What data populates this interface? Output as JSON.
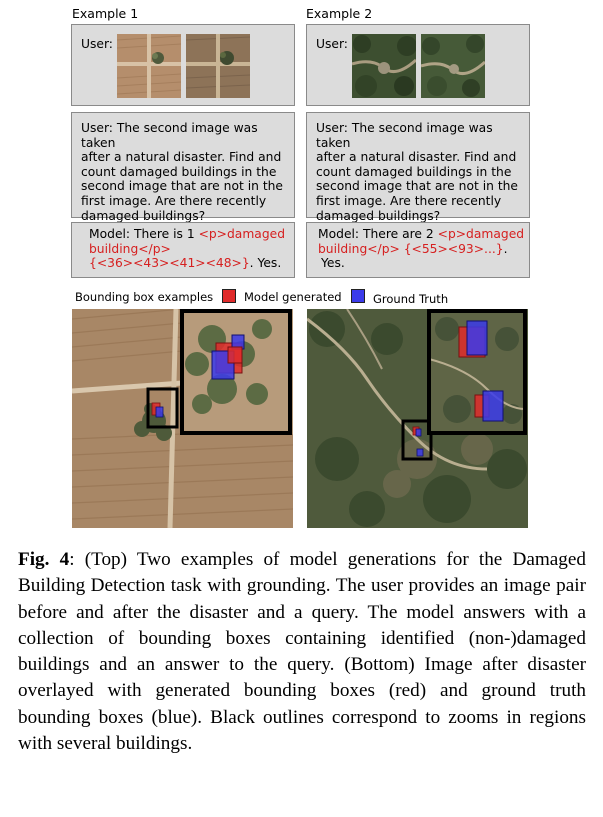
{
  "example1": {
    "title": "Example 1",
    "user_label": "User:",
    "query_lines": [
      "User: The second image was taken",
      "after a natural disaster. Find and",
      "count damaged buildings in the",
      "second image that are not in the",
      "first image. Are there recently",
      "damaged buildings?"
    ],
    "model_line1_prefix": "Model: There is 1 ",
    "model_line1_tag": "<p>damaged",
    "model_line2_tag": "building</p>",
    "model_line3_boxes": "{<36><43><41><48>}",
    "model_line3_suffix": ". Yes."
  },
  "example2": {
    "title": "Example 2",
    "user_label": "User:",
    "query_lines": [
      "User: The second image was taken",
      "after a natural disaster. Find and",
      "count damaged buildings in the",
      "second image that are not in the",
      "first image. Are there recently",
      "damaged buildings?"
    ],
    "model_line1_prefix": "Model: There are 2 ",
    "model_line1_tag": "<p>damaged",
    "model_line2_tag": "building</p> {<55><93>...}",
    "model_line2_suffix": ".",
    "model_line3": "Yes."
  },
  "legend": {
    "title": "Bounding box examples",
    "generated_label": "Model generated",
    "ground_truth_label": "Ground Truth",
    "generated_color": "#e02b2b",
    "ground_truth_color": "#3b3bea"
  },
  "caption": {
    "label": "Fig. 4",
    "text": ": (Top) Two examples of model generations for the Damaged Building Detection task with grounding. The user provides an image pair before and after the disaster and a query. The model answers with a collection of bounding boxes containing identified (non-)damaged buildings and an answer to the query. (Bottom) Image after disaster overlayed with generated bounding boxes (red) and ground truth bounding boxes (blue). Black outlines correspond to zooms in regions with several buildings."
  }
}
